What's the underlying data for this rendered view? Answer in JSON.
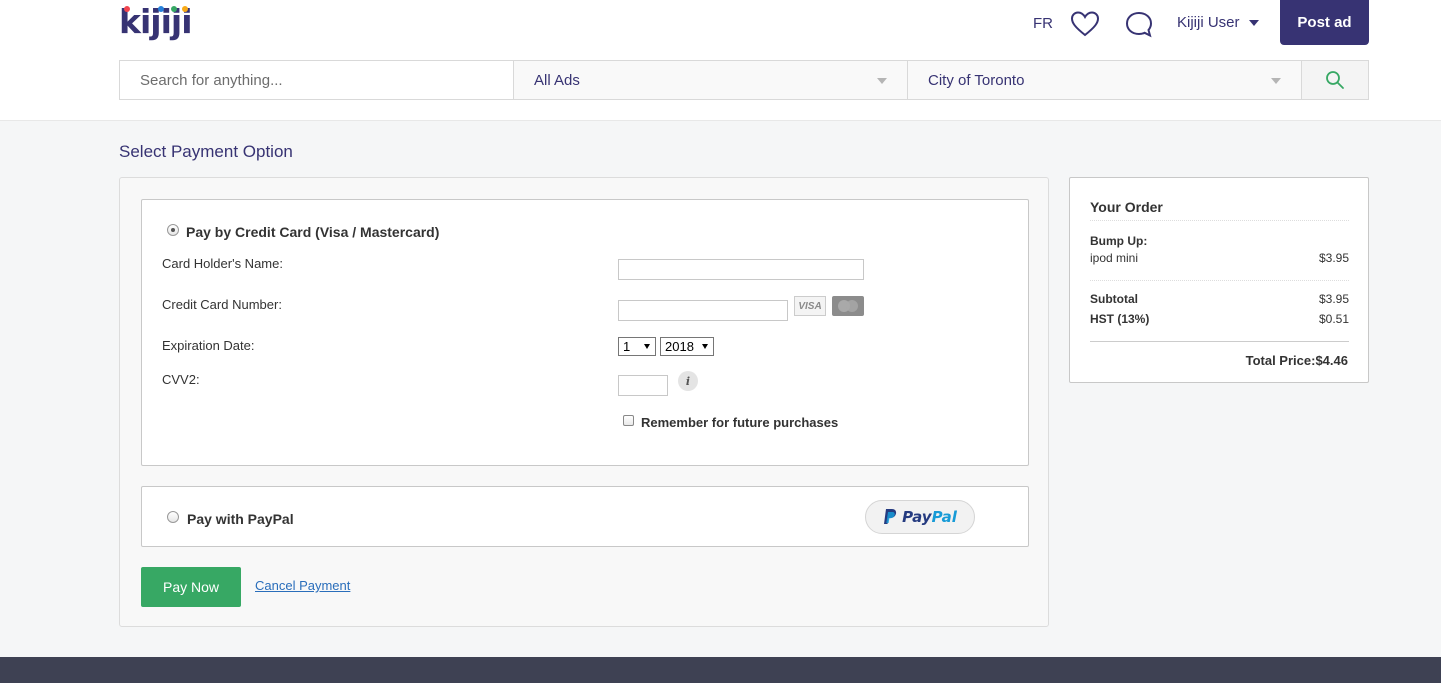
{
  "header": {
    "logo": "kijiji",
    "lang": "FR",
    "user": "Kijiji User",
    "post_ad": "Post ad"
  },
  "search": {
    "placeholder": "Search for anything...",
    "category": "All Ads",
    "location": "City of Toronto"
  },
  "page_title": "Select Payment Option",
  "credit_card": {
    "option_label": "Pay by Credit Card (Visa / Mastercard)",
    "holder_label": "Card Holder's Name:",
    "number_label": "Credit Card Number:",
    "expiry_label": "Expiration Date:",
    "cvv_label": "CVV2:",
    "month_value": "1",
    "year_value": "2018",
    "visa_label": "VISA",
    "remember_label": "Remember for future purchases"
  },
  "paypal": {
    "option_label": "Pay with PayPal",
    "logo_text_1": "Pay",
    "logo_text_2": "Pal"
  },
  "actions": {
    "pay_now": "Pay Now",
    "cancel": "Cancel Payment"
  },
  "order": {
    "title": "Your Order",
    "item_heading": "Bump Up:",
    "item_name": "ipod mini",
    "item_price": "$3.95",
    "subtotal_label": "Subtotal",
    "subtotal_value": "$3.95",
    "tax_label": "HST (13%)",
    "tax_value": "$0.51",
    "total_label": "Total Price:",
    "total_value": "$4.46"
  },
  "colors": {
    "brand": "#373373",
    "pay_now": "#37a864",
    "link": "#2a6ebb"
  }
}
